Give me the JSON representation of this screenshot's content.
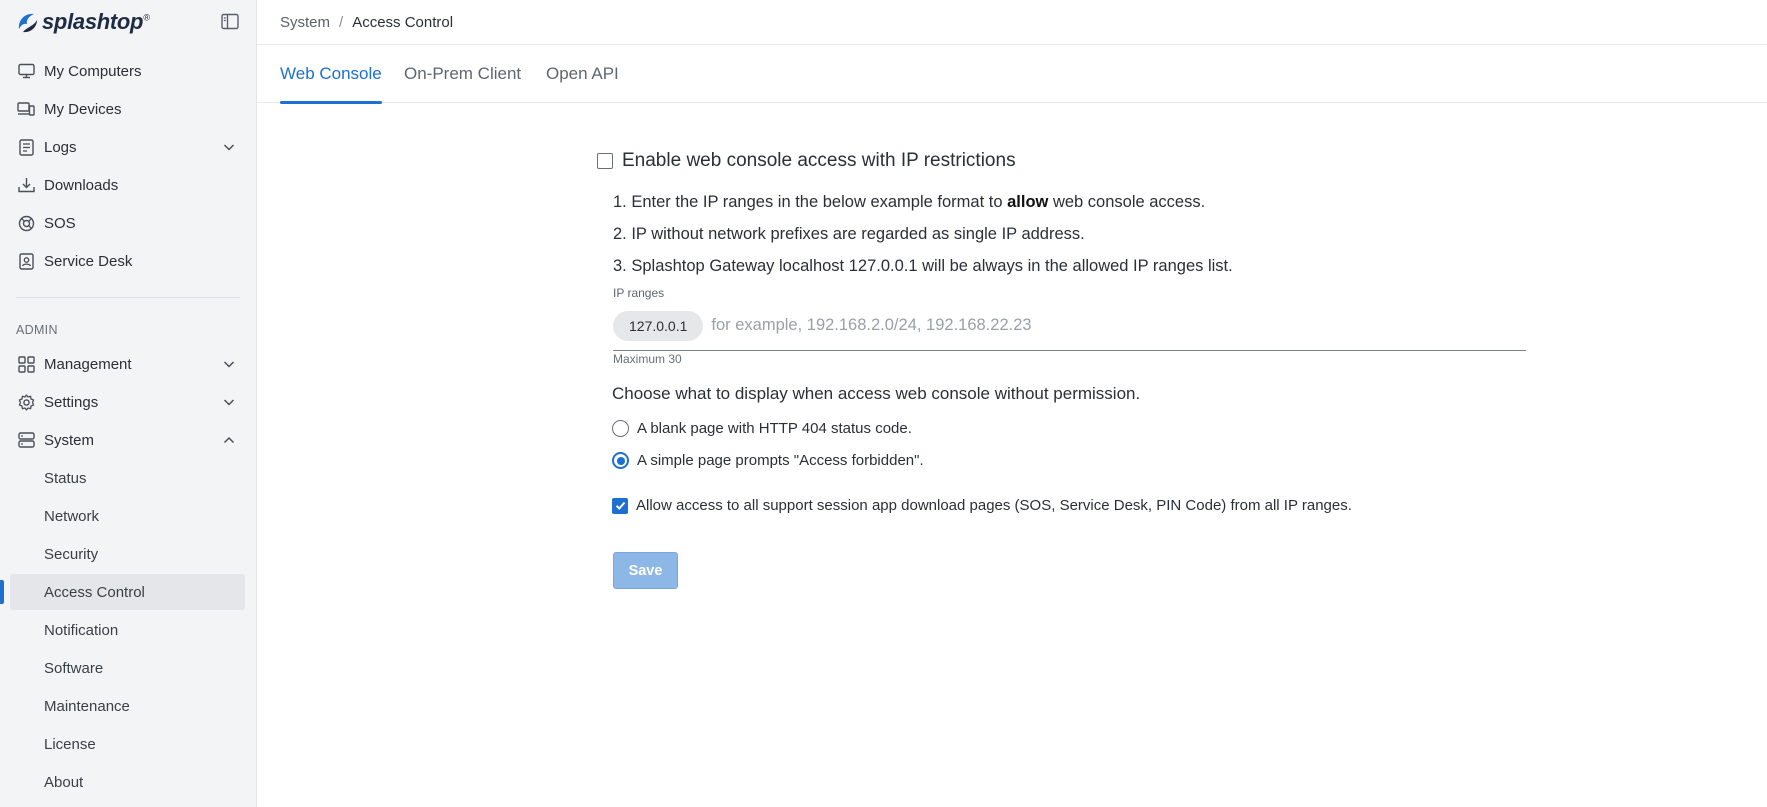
{
  "app": {
    "brand": "splashtop",
    "brand_mark": "®"
  },
  "sidebar": {
    "items": [
      {
        "label": "My Computers",
        "icon": "monitor-icon"
      },
      {
        "label": "My Devices",
        "icon": "devices-icon"
      },
      {
        "label": "Logs",
        "icon": "log-icon",
        "expandable": true
      },
      {
        "label": "Downloads",
        "icon": "download-icon"
      },
      {
        "label": "SOS",
        "icon": "sos-icon"
      },
      {
        "label": "Service Desk",
        "icon": "service-desk-icon"
      }
    ],
    "admin_label": "ADMIN",
    "admin_items": [
      {
        "label": "Management",
        "icon": "grid-icon",
        "expandable": true
      },
      {
        "label": "Settings",
        "icon": "gear-icon",
        "expandable": true
      },
      {
        "label": "System",
        "icon": "server-icon",
        "expanded": true
      }
    ],
    "system_subitems": [
      {
        "label": "Status"
      },
      {
        "label": "Network"
      },
      {
        "label": "Security"
      },
      {
        "label": "Access Control",
        "active": true
      },
      {
        "label": "Notification"
      },
      {
        "label": "Software"
      },
      {
        "label": "Maintenance"
      },
      {
        "label": "License"
      },
      {
        "label": "About"
      }
    ]
  },
  "breadcrumb": {
    "parent": "System",
    "separator": "/",
    "current": "Access Control"
  },
  "tabs": [
    {
      "label": "Web Console",
      "active": true
    },
    {
      "label": "On-Prem Client"
    },
    {
      "label": "Open API"
    }
  ],
  "web_console": {
    "enable_label": "Enable web console access with IP restrictions",
    "enable_checked": false,
    "rule1_pre": "1. Enter the IP ranges in the below example format to ",
    "rule1_bold": "allow",
    "rule1_post": " web console access.",
    "rule2": "2. IP without network prefixes are regarded as single IP address.",
    "rule3": "3. Splashtop Gateway localhost 127.0.0.1 will be always in the allowed IP ranges list.",
    "ip_label": "IP ranges",
    "ip_chip": "127.0.0.1",
    "ip_placeholder": "for example, 192.168.2.0/24, 192.168.22.23",
    "ip_help": "Maximum 30",
    "choose_label": "Choose what to display when access web console without permission.",
    "radio_options": [
      {
        "label": "A blank page with HTTP 404 status code.",
        "selected": false
      },
      {
        "label": "A simple page prompts \"Access forbidden\".",
        "selected": true
      }
    ],
    "allow_label": "Allow access to all support session app download pages (SOS, Service Desk, PIN Code) from all IP ranges.",
    "allow_checked": true,
    "save_label": "Save"
  },
  "colors": {
    "accent": "#1d6fd1",
    "sidebar_bg": "#f3f4f6",
    "save_disabled": "#8db7e6"
  }
}
